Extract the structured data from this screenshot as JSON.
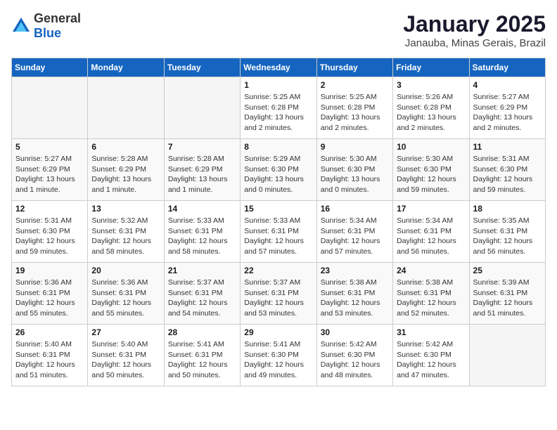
{
  "logo": {
    "text_general": "General",
    "text_blue": "Blue"
  },
  "title": "January 2025",
  "subtitle": "Janauba, Minas Gerais, Brazil",
  "days_of_week": [
    "Sunday",
    "Monday",
    "Tuesday",
    "Wednesday",
    "Thursday",
    "Friday",
    "Saturday"
  ],
  "weeks": [
    [
      {
        "day": null,
        "info": null
      },
      {
        "day": null,
        "info": null
      },
      {
        "day": null,
        "info": null
      },
      {
        "day": "1",
        "sunrise": "Sunrise: 5:25 AM",
        "sunset": "Sunset: 6:28 PM",
        "daylight": "Daylight: 13 hours and 2 minutes."
      },
      {
        "day": "2",
        "sunrise": "Sunrise: 5:25 AM",
        "sunset": "Sunset: 6:28 PM",
        "daylight": "Daylight: 13 hours and 2 minutes."
      },
      {
        "day": "3",
        "sunrise": "Sunrise: 5:26 AM",
        "sunset": "Sunset: 6:28 PM",
        "daylight": "Daylight: 13 hours and 2 minutes."
      },
      {
        "day": "4",
        "sunrise": "Sunrise: 5:27 AM",
        "sunset": "Sunset: 6:29 PM",
        "daylight": "Daylight: 13 hours and 2 minutes."
      }
    ],
    [
      {
        "day": "5",
        "sunrise": "Sunrise: 5:27 AM",
        "sunset": "Sunset: 6:29 PM",
        "daylight": "Daylight: 13 hours and 1 minute."
      },
      {
        "day": "6",
        "sunrise": "Sunrise: 5:28 AM",
        "sunset": "Sunset: 6:29 PM",
        "daylight": "Daylight: 13 hours and 1 minute."
      },
      {
        "day": "7",
        "sunrise": "Sunrise: 5:28 AM",
        "sunset": "Sunset: 6:29 PM",
        "daylight": "Daylight: 13 hours and 1 minute."
      },
      {
        "day": "8",
        "sunrise": "Sunrise: 5:29 AM",
        "sunset": "Sunset: 6:30 PM",
        "daylight": "Daylight: 13 hours and 0 minutes."
      },
      {
        "day": "9",
        "sunrise": "Sunrise: 5:30 AM",
        "sunset": "Sunset: 6:30 PM",
        "daylight": "Daylight: 13 hours and 0 minutes."
      },
      {
        "day": "10",
        "sunrise": "Sunrise: 5:30 AM",
        "sunset": "Sunset: 6:30 PM",
        "daylight": "Daylight: 12 hours and 59 minutes."
      },
      {
        "day": "11",
        "sunrise": "Sunrise: 5:31 AM",
        "sunset": "Sunset: 6:30 PM",
        "daylight": "Daylight: 12 hours and 59 minutes."
      }
    ],
    [
      {
        "day": "12",
        "sunrise": "Sunrise: 5:31 AM",
        "sunset": "Sunset: 6:30 PM",
        "daylight": "Daylight: 12 hours and 59 minutes."
      },
      {
        "day": "13",
        "sunrise": "Sunrise: 5:32 AM",
        "sunset": "Sunset: 6:31 PM",
        "daylight": "Daylight: 12 hours and 58 minutes."
      },
      {
        "day": "14",
        "sunrise": "Sunrise: 5:33 AM",
        "sunset": "Sunset: 6:31 PM",
        "daylight": "Daylight: 12 hours and 58 minutes."
      },
      {
        "day": "15",
        "sunrise": "Sunrise: 5:33 AM",
        "sunset": "Sunset: 6:31 PM",
        "daylight": "Daylight: 12 hours and 57 minutes."
      },
      {
        "day": "16",
        "sunrise": "Sunrise: 5:34 AM",
        "sunset": "Sunset: 6:31 PM",
        "daylight": "Daylight: 12 hours and 57 minutes."
      },
      {
        "day": "17",
        "sunrise": "Sunrise: 5:34 AM",
        "sunset": "Sunset: 6:31 PM",
        "daylight": "Daylight: 12 hours and 56 minutes."
      },
      {
        "day": "18",
        "sunrise": "Sunrise: 5:35 AM",
        "sunset": "Sunset: 6:31 PM",
        "daylight": "Daylight: 12 hours and 56 minutes."
      }
    ],
    [
      {
        "day": "19",
        "sunrise": "Sunrise: 5:36 AM",
        "sunset": "Sunset: 6:31 PM",
        "daylight": "Daylight: 12 hours and 55 minutes."
      },
      {
        "day": "20",
        "sunrise": "Sunrise: 5:36 AM",
        "sunset": "Sunset: 6:31 PM",
        "daylight": "Daylight: 12 hours and 55 minutes."
      },
      {
        "day": "21",
        "sunrise": "Sunrise: 5:37 AM",
        "sunset": "Sunset: 6:31 PM",
        "daylight": "Daylight: 12 hours and 54 minutes."
      },
      {
        "day": "22",
        "sunrise": "Sunrise: 5:37 AM",
        "sunset": "Sunset: 6:31 PM",
        "daylight": "Daylight: 12 hours and 53 minutes."
      },
      {
        "day": "23",
        "sunrise": "Sunrise: 5:38 AM",
        "sunset": "Sunset: 6:31 PM",
        "daylight": "Daylight: 12 hours and 53 minutes."
      },
      {
        "day": "24",
        "sunrise": "Sunrise: 5:38 AM",
        "sunset": "Sunset: 6:31 PM",
        "daylight": "Daylight: 12 hours and 52 minutes."
      },
      {
        "day": "25",
        "sunrise": "Sunrise: 5:39 AM",
        "sunset": "Sunset: 6:31 PM",
        "daylight": "Daylight: 12 hours and 51 minutes."
      }
    ],
    [
      {
        "day": "26",
        "sunrise": "Sunrise: 5:40 AM",
        "sunset": "Sunset: 6:31 PM",
        "daylight": "Daylight: 12 hours and 51 minutes."
      },
      {
        "day": "27",
        "sunrise": "Sunrise: 5:40 AM",
        "sunset": "Sunset: 6:31 PM",
        "daylight": "Daylight: 12 hours and 50 minutes."
      },
      {
        "day": "28",
        "sunrise": "Sunrise: 5:41 AM",
        "sunset": "Sunset: 6:31 PM",
        "daylight": "Daylight: 12 hours and 50 minutes."
      },
      {
        "day": "29",
        "sunrise": "Sunrise: 5:41 AM",
        "sunset": "Sunset: 6:30 PM",
        "daylight": "Daylight: 12 hours and 49 minutes."
      },
      {
        "day": "30",
        "sunrise": "Sunrise: 5:42 AM",
        "sunset": "Sunset: 6:30 PM",
        "daylight": "Daylight: 12 hours and 48 minutes."
      },
      {
        "day": "31",
        "sunrise": "Sunrise: 5:42 AM",
        "sunset": "Sunset: 6:30 PM",
        "daylight": "Daylight: 12 hours and 47 minutes."
      },
      {
        "day": null,
        "info": null
      }
    ]
  ]
}
